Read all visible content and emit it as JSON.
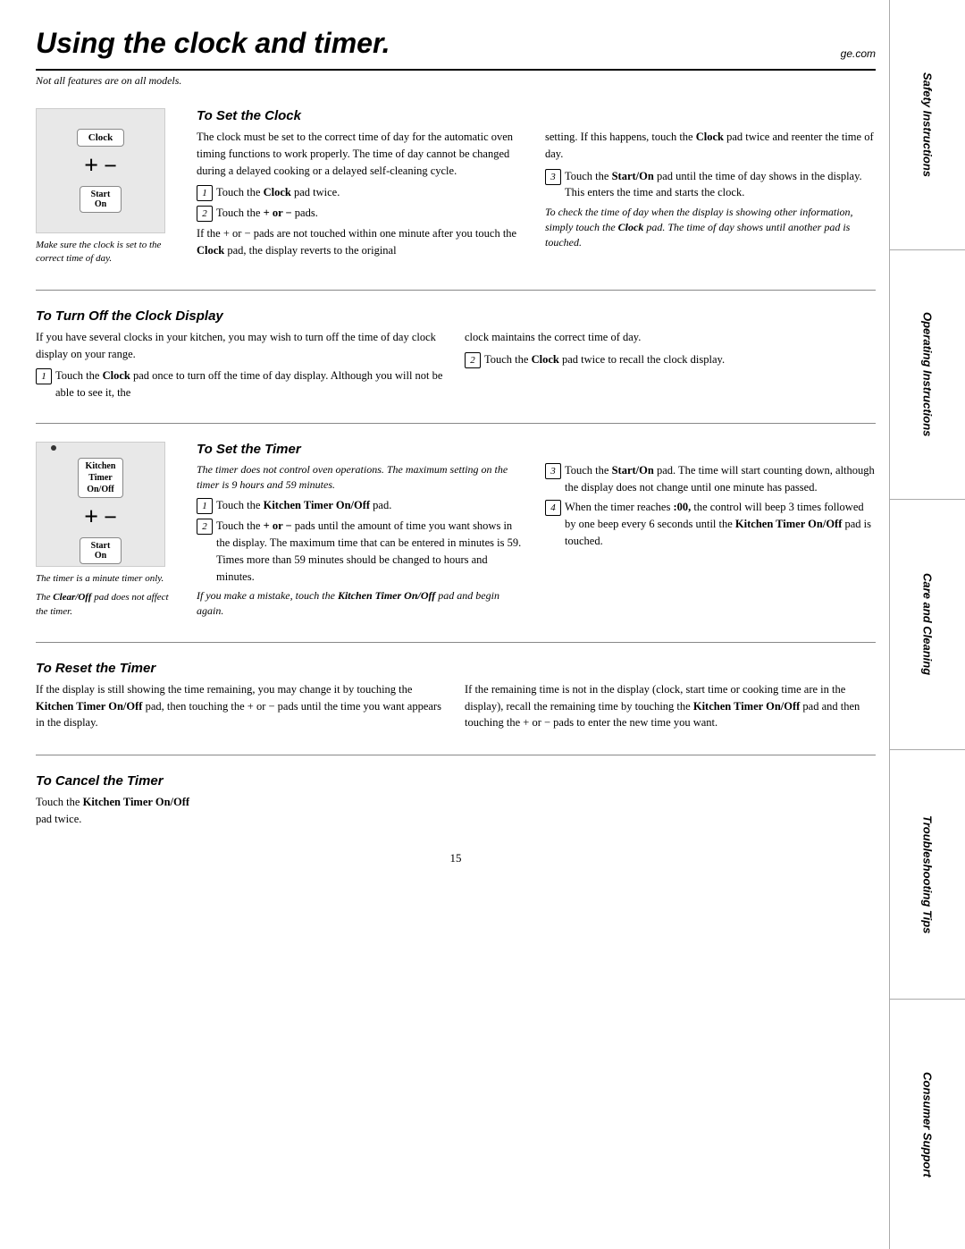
{
  "page": {
    "title": "Using the clock and timer.",
    "ge_com": "ge.com",
    "subtitle": "Not all features are on all models.",
    "page_number": "15"
  },
  "sidebar": {
    "items": [
      "Safety Instructions",
      "Operating Instructions",
      "Care and Cleaning",
      "Troubleshooting Tips",
      "Consumer Support"
    ]
  },
  "set_clock": {
    "heading": "To Set the Clock",
    "image_caption": "Make sure the clock is set to the correct time of day.",
    "clock_button": "Clock",
    "start_on_button": "Start\nOn",
    "body1": "The clock must be set to the correct time of day for the automatic oven timing functions to work properly. The time of day cannot be changed during a delayed cooking or a delayed self-cleaning cycle.",
    "step1": "Touch the ",
    "step1_bold": "Clock",
    "step1_rest": " pad twice.",
    "step2": "Touch the ",
    "step2_bold": "+ or −",
    "step2_rest": " pads.",
    "body2": "If the + or − pads are not touched within one minute after you touch the ",
    "body2_bold": "Clock",
    "body2_rest": " pad, the display reverts to the original",
    "right_body1": "setting. If this happens, touch the ",
    "right_body1_bold": "Clock",
    "right_body1_rest": " pad twice and reenter the time of day.",
    "step3": "Touch the ",
    "step3_bold": "Start/On",
    "step3_rest": " pad until the time of day shows in the display. This enters the time and starts the clock.",
    "italic_note": "To check the time of day when the display is showing other information, simply touch the Clock pad. The time of day shows until another pad is touched."
  },
  "turn_off_clock": {
    "heading": "To Turn Off the Clock Display",
    "body1": "If you have several clocks in your kitchen, you may wish to turn off the time of day clock display on your range.",
    "step1": "Touch the ",
    "step1_bold": "Clock",
    "step1_rest": " pad once to turn off the time of day display. Although you will not be able to see it, the",
    "right_body1": "clock maintains the correct time of day.",
    "step2": "Touch the ",
    "step2_bold": "Clock",
    "step2_rest": " pad twice to recall the clock display."
  },
  "set_timer": {
    "heading": "To Set the Timer",
    "italic_note1": "The timer does not control oven operations. The maximum setting on the timer is 9 hours and 59 minutes.",
    "kitchen_timer_label": "Kitchen\nTimer\nOn/Off",
    "start_on_button": "Start\nOn",
    "image_caption1": "The timer is a minute timer only.",
    "image_caption2": "The Clear/Off pad does not affect the timer.",
    "step1": "Touch the ",
    "step1_bold": "Kitchen Timer On/Off",
    "step1_rest": " pad.",
    "step2": "Touch the ",
    "step2_bold": "+ or −",
    "step2_rest": " pads until the amount of time you want shows in the display. The maximum time that can be entered in minutes is 59. Times more than 59 minutes should be changed to hours and minutes.",
    "italic_note2": "If you make a mistake, touch the Kitchen Timer On/Off pad and begin again.",
    "italic_note2_bold": "Kitchen Timer On/Off",
    "step3": "Touch the ",
    "step3_bold": "Start/On",
    "step3_rest": " pad. The time will start counting down, although the display does not change until one minute has passed.",
    "step4": "When the timer reaches ",
    "step4_bold1": ":00,",
    "step4_mid": " the control will beep 3 times followed by one beep every 6 seconds until the ",
    "step4_bold2": "Kitchen Timer On/Off",
    "step4_rest": " pad is touched."
  },
  "reset_timer": {
    "heading": "To Reset the Timer",
    "body1": "If the display is still showing the time remaining, you may change it by touching the ",
    "body1_bold": "Kitchen Timer On/Off",
    "body1_rest": " pad, then touching the + or − pads until the time you want appears in the display.",
    "body2": "If the remaining time is not in the display (clock, start time or cooking time are in the display), recall the remaining time by touching the ",
    "body2_bold": "Kitchen Timer On/Off",
    "body2_rest": " pad and then touching the + or − pads to enter the new time you want."
  },
  "cancel_timer": {
    "heading": "To Cancel the Timer",
    "body1": "Touch the ",
    "body1_bold": "Kitchen Timer On/Off",
    "body1_rest": " pad twice."
  }
}
